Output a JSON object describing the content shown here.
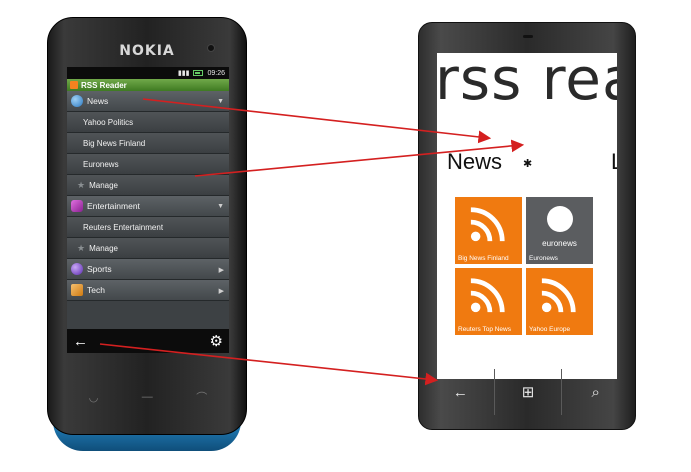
{
  "nokia": {
    "brand": "NOKIA",
    "status_time": "09:26",
    "app_title": "RSS Reader",
    "categories": [
      {
        "label": "News",
        "icon": "globe-icon",
        "color": "#3a8fd0",
        "expanded": true,
        "feeds": [
          "Yahoo Politics",
          "Big News Finland",
          "Euronews"
        ],
        "manage": "Manage"
      },
      {
        "label": "Entertainment",
        "icon": "music-icon",
        "color": "#c040c0",
        "expanded": true,
        "feeds": [
          "Reuters Entertainment"
        ],
        "manage": "Manage"
      },
      {
        "label": "Sports",
        "icon": "ball-icon",
        "color": "#8050d0",
        "expanded": false
      },
      {
        "label": "Tech",
        "icon": "tech-icon",
        "color": "#e89a30",
        "expanded": false
      }
    ],
    "softkeys": {
      "back": "←",
      "settings": "⚙"
    },
    "hardkeys": {
      "call": "◡",
      "menu": "—",
      "end": "⌒"
    }
  },
  "wp": {
    "title": "rss rea",
    "pivot_current": "News",
    "pivot_gear": "✱",
    "pivot_next": "L",
    "tiles": [
      {
        "label": "Big News Finland",
        "kind": "rss",
        "color": "#f07a10"
      },
      {
        "label": "Euronews",
        "kind": "euronews",
        "color": "#5b5d60",
        "logo_text": "euronews"
      },
      {
        "label": "Reuters Top News",
        "kind": "rss",
        "color": "#f07a10"
      },
      {
        "label": "Yahoo Europe",
        "kind": "rss",
        "color": "#f07a10"
      }
    ],
    "nav": {
      "back": "←",
      "start": "⊞",
      "search": "⌕"
    }
  },
  "colors": {
    "arrow": "#d42020",
    "rss_orange": "#f07a10"
  }
}
